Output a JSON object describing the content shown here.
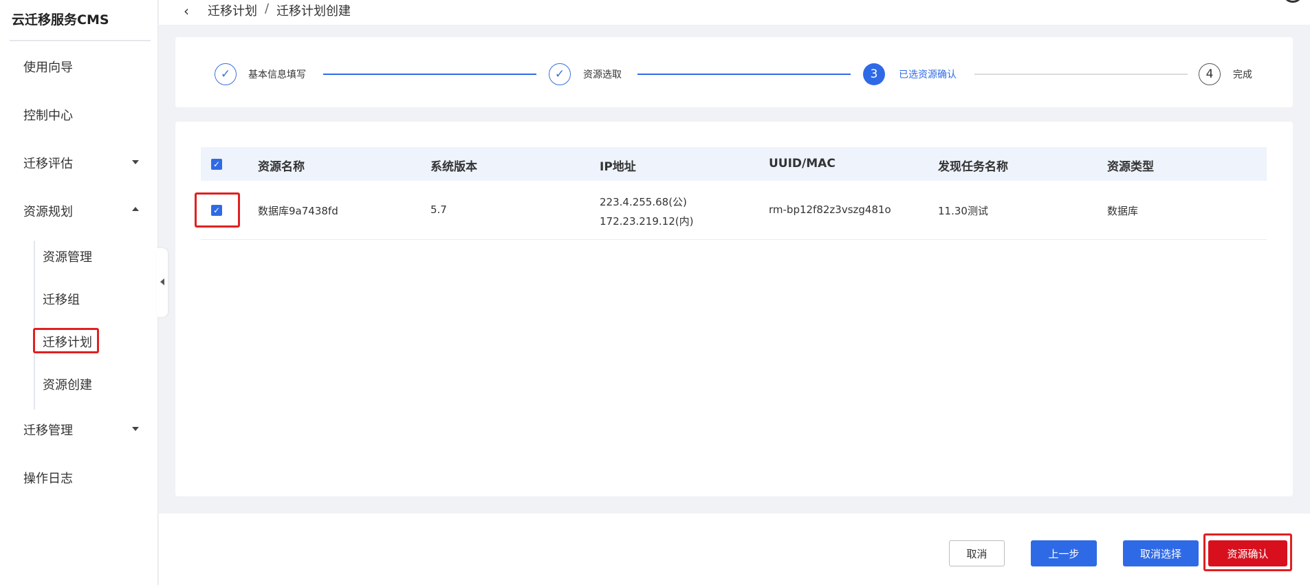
{
  "sidebar": {
    "brand": "云迁移服务CMS",
    "items": [
      {
        "label": "使用向导"
      },
      {
        "label": "控制中心"
      },
      {
        "label": "迁移评估"
      },
      {
        "label": "资源规划"
      },
      {
        "label": "迁移管理"
      },
      {
        "label": "操作日志"
      }
    ],
    "sub_items": [
      {
        "label": "资源管理"
      },
      {
        "label": "迁移组"
      },
      {
        "label": "迁移计划"
      },
      {
        "label": "资源创建"
      }
    ]
  },
  "header": {
    "breadcrumb_parent": "迁移计划",
    "breadcrumb_separator": "/",
    "breadcrumb_current": "迁移计划创建"
  },
  "steps": [
    {
      "label": "基本信息填写",
      "status": "done",
      "number": "1"
    },
    {
      "label": "资源选取",
      "status": "done",
      "number": "2"
    },
    {
      "label": "已选资源确认",
      "status": "active",
      "number": "3"
    },
    {
      "label": "完成",
      "status": "todo",
      "number": "4"
    }
  ],
  "table": {
    "headers": [
      "资源名称",
      "系统版本",
      "IP地址",
      "UUID/MAC",
      "发现任务名称",
      "资源类型"
    ],
    "rows": [
      {
        "checked": true,
        "name": "数据库9a7438fd",
        "version": "5.7",
        "ip_public": "223.4.255.68(公)",
        "ip_private": "172.23.219.12(内)",
        "uuid": "rm-bp12f82z3vszg481o",
        "task": "11.30测试",
        "type": "数据库"
      }
    ]
  },
  "footer": {
    "cancel": "取消",
    "prev": "上一步",
    "deselect": "取消选择",
    "confirm": "资源确认"
  },
  "colors": {
    "primary": "#2f6ae6",
    "danger": "#d8101e",
    "highlight": "#e02020"
  }
}
